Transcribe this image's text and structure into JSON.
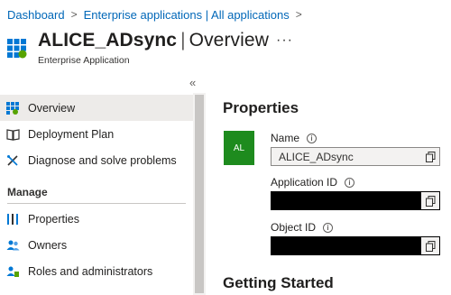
{
  "breadcrumb": {
    "items": [
      "Dashboard",
      "Enterprise applications | All applications"
    ],
    "separator": ">"
  },
  "header": {
    "app_name": "ALICE_ADsync",
    "divider": "|",
    "section": "Overview",
    "more_label": "···",
    "subtitle": "Enterprise Application",
    "icon": "enterprise-app-grid-icon"
  },
  "sidebar": {
    "collapse_label": "«",
    "items": [
      {
        "label": "Overview",
        "icon": "overview-grid-icon",
        "active": true
      },
      {
        "label": "Deployment Plan",
        "icon": "book-icon"
      },
      {
        "label": "Diagnose and solve problems",
        "icon": "wrench-icon"
      }
    ],
    "section_title": "Manage",
    "manage_items": [
      {
        "label": "Properties",
        "icon": "properties-bars-icon"
      },
      {
        "label": "Owners",
        "icon": "people-icon"
      },
      {
        "label": "Roles and administrators",
        "icon": "user-role-icon"
      }
    ]
  },
  "main": {
    "properties_title": "Properties",
    "tile_initials": "AL",
    "fields": {
      "name": {
        "label": "Name",
        "value": "ALICE_ADsync"
      },
      "application_id": {
        "label": "Application ID",
        "value": ""
      },
      "object_id": {
        "label": "Object ID",
        "value": ""
      }
    },
    "next_heading": "Getting Started"
  },
  "colors": {
    "link": "#0067b8",
    "tile": "#1e8b1e",
    "active_nav": "#edebe9",
    "masked": "#000000"
  }
}
